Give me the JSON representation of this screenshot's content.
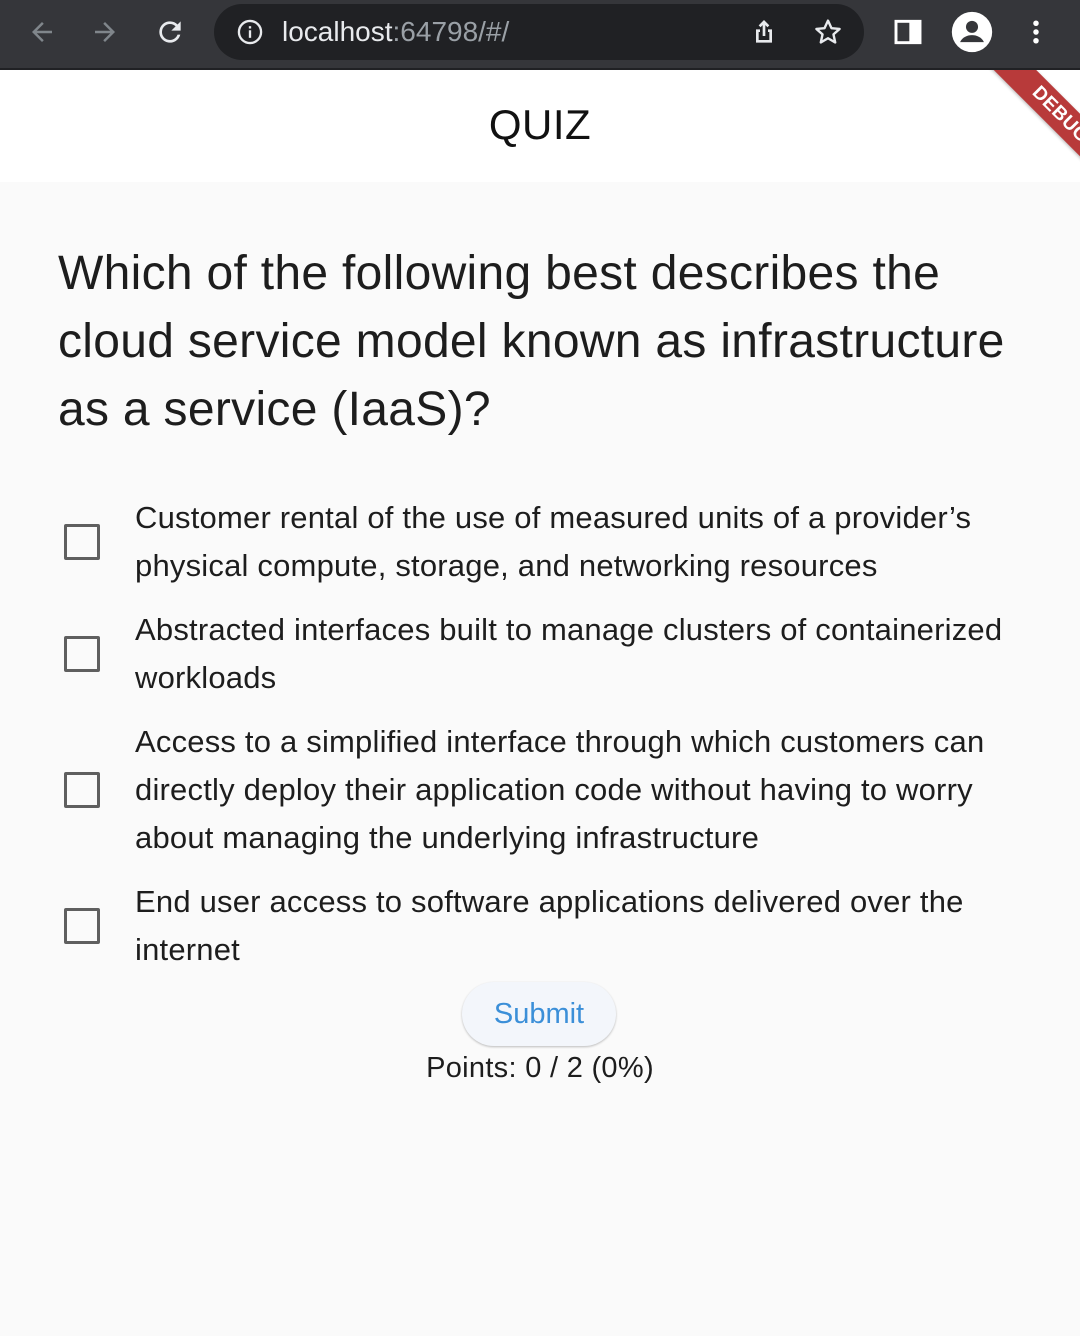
{
  "browser": {
    "url_host": "localhost",
    "url_rest": ":64798/#/"
  },
  "app": {
    "title": "QUIZ",
    "debug_banner": "DEBUG"
  },
  "quiz": {
    "question": "Which of the following best describes the cloud service model known as infrastructure as a service (IaaS)?",
    "options": [
      {
        "label": "Customer rental of the use of measured units of a provider’s physical compute, storage, and networking resources",
        "checked": false
      },
      {
        "label": "Abstracted interfaces built to manage clusters of containerized workloads",
        "checked": false
      },
      {
        "label": "Access to a simplified interface through which customers can directly deploy their application code without having to worry about managing the underlying infrastructure",
        "checked": false
      },
      {
        "label": "End user access to software applications delivered over the internet",
        "checked": false
      }
    ],
    "submit_label": "Submit",
    "points_text": "Points: 0 / 2 (0%)"
  },
  "colors": {
    "browser_bar": "#35363a",
    "omnibox": "#202124",
    "accent": "#3b8fd8",
    "debug_ribbon": "#b83a3a",
    "page_background": "#fafafa"
  },
  "icons": [
    "back-arrow-icon",
    "forward-arrow-icon",
    "reload-icon",
    "info-icon",
    "share-icon",
    "star-icon",
    "side-panel-icon",
    "profile-icon",
    "more-vert-icon"
  ]
}
